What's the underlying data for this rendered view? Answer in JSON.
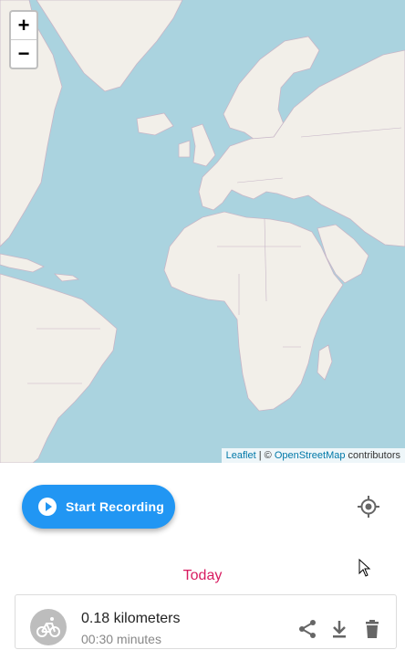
{
  "map": {
    "zoom_in": "+",
    "zoom_out": "−",
    "attribution_leaflet": "Leaflet",
    "attribution_sep": " | © ",
    "attribution_osm": "OpenStreetMap",
    "attribution_suffix": " contributors"
  },
  "controls": {
    "record_label": "Start Recording",
    "record_icon": "play-circle-icon",
    "locate_icon": "my-location-icon"
  },
  "history": {
    "day_label": "Today",
    "entries": [
      {
        "distance": "0.18 kilometers",
        "duration": "00:30 minutes",
        "activity_icon": "bicycle-icon",
        "actions": [
          "share-icon",
          "download-icon",
          "delete-icon"
        ]
      }
    ]
  },
  "colors": {
    "accent": "#2196f3",
    "day_header": "#d81b60",
    "ocean": "#aad3df",
    "land": "#f2efe9"
  }
}
